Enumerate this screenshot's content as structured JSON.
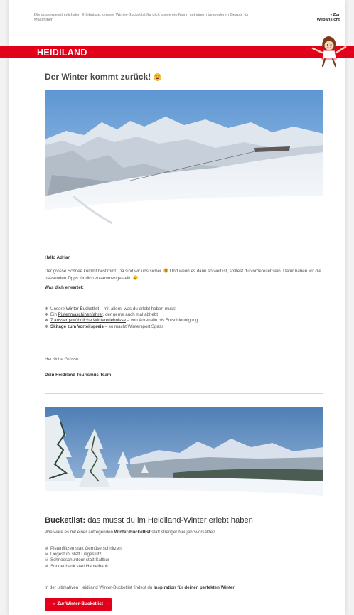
{
  "preheader": "Die aussergewöhnlichsten Erlebnisse, unsere Winter-Bucketlist für dich sowie ein Mann mit einem besonderen Gespür für Maschinen",
  "webview": {
    "line1": "› Zur",
    "line2": "Webansicht"
  },
  "brand": {
    "logo": "HEIDILAND",
    "color": "#e3001b"
  },
  "title": "Der Winter kommt zurück!",
  "greeting": "Hallo Adrian",
  "intro": {
    "part1": "Der grosse Schnee kommt bestimmt. Da sind wir uns sicher.",
    "part2": "Und wenn es dann so weit ist, solltest du vorbereitet sein. Dafür haben wir die passenden Tipps für dich zusammengestellt."
  },
  "expect_heading": "Was dich erwartet:",
  "expect_items": [
    {
      "pre": "Unsere ",
      "link": "Winter-Bucketlist",
      "post": " – mit allem, was du erlebt haben musst"
    },
    {
      "pre": "Ein ",
      "link": "Pistenmaschinenfahrer",
      "post": ", der gerne auch mal abhebt"
    },
    {
      "pre": "",
      "link": "7 aussergewöhnliche Wintererlebnisse",
      "post": " – von Adrenalin bis Entschleunigung"
    },
    {
      "pre": "",
      "link": "Skitage zum Vorteilspreis",
      "post": " – so macht Wintersport Spass"
    }
  ],
  "regards": "Herzliche Grüsse",
  "team": "Dein Heidiland Tourismus Team",
  "bucketlist": {
    "heading_bold": "Bucketlist:",
    "heading_rest": " das musst du im Heidiland-Winter erlebt haben",
    "intro_pre": "Wie wäre es mit einer aufregenden ",
    "intro_bold": "Winter-Bucketlist",
    "intro_post": " statt strenger Neujahrsvorsätze?",
    "items": [
      "Pistenflitzen statt Gemüse schnitzen",
      "Liegestuhl statt Liegestütz",
      "Schneeschuhtour statt Saftkur",
      "Sonnenbank statt Hantelbank"
    ],
    "outro_pre": "In der ultimativen Heidiland Winter-Bucketlist findest du ",
    "outro_bold": "Inspiration für deinen perfekten Winter",
    "outro_post": ".",
    "cta": "»  Zur Winter-Bucketlist"
  },
  "colors": {
    "accent": "#e3001b",
    "text": "#555555",
    "heading": "#4a4a4a"
  },
  "icons": {
    "list1_bullet": "snowflake-icon",
    "list2_bullet": "skull-icon",
    "title_emoji": "heart-eyes-emoji-icon"
  }
}
